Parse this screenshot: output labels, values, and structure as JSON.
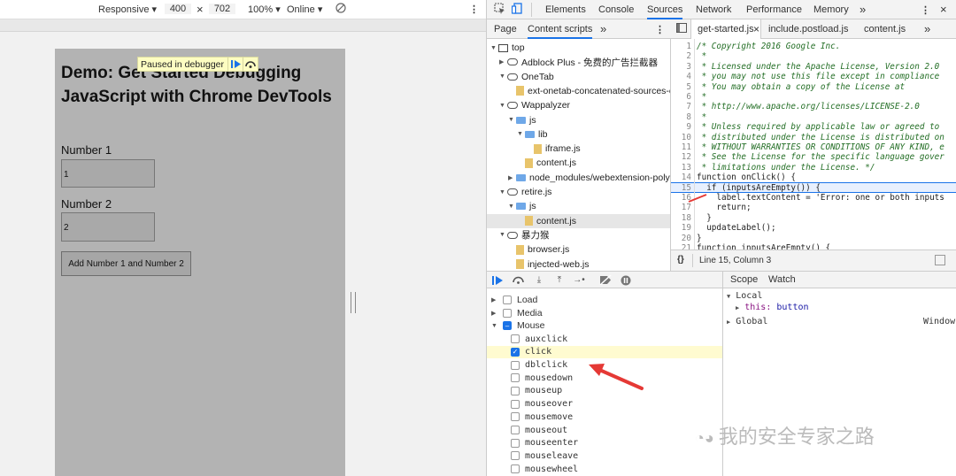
{
  "device_toolbar": {
    "mode": "Responsive",
    "width": "400",
    "x": "×",
    "height": "702",
    "zoom": "100%",
    "throttle": "Online"
  },
  "page": {
    "title": "Demo: Get Started Debugging JavaScript with Chrome DevTools",
    "paused_label": "Paused in debugger",
    "number1_label": "Number 1",
    "number1_value": "1",
    "number2_label": "Number 2",
    "number2_value": "2",
    "button_label": "Add Number 1 and Number 2"
  },
  "devtools": {
    "tabs": [
      "Elements",
      "Console",
      "Sources",
      "Network",
      "Performance",
      "Memory"
    ],
    "active_tab": "Sources",
    "more": "»",
    "navigator_tabs": {
      "page": "Page",
      "content_scripts": "Content scripts"
    },
    "tree": [
      {
        "label": "top",
        "icon": "frame",
        "depth": 0,
        "open": true
      },
      {
        "label": "Adblock Plus - 免费的广告拦截器",
        "icon": "cloud",
        "depth": 1,
        "open": false
      },
      {
        "label": "OneTab",
        "icon": "cloud",
        "depth": 1,
        "open": true
      },
      {
        "label": "ext-onetab-concatenated-sources-c",
        "icon": "file",
        "depth": 2,
        "open": null
      },
      {
        "label": "Wappalyzer",
        "icon": "cloud",
        "depth": 1,
        "open": true
      },
      {
        "label": "js",
        "icon": "folder",
        "depth": 2,
        "open": true
      },
      {
        "label": "lib",
        "icon": "folder",
        "depth": 3,
        "open": true
      },
      {
        "label": "iframe.js",
        "icon": "file",
        "depth": 4,
        "open": null
      },
      {
        "label": "content.js",
        "icon": "file",
        "depth": 3,
        "open": null
      },
      {
        "label": "node_modules/webextension-polyfil",
        "icon": "folder",
        "depth": 2,
        "open": false
      },
      {
        "label": "retire.js",
        "icon": "cloud",
        "depth": 1,
        "open": true
      },
      {
        "label": "js",
        "icon": "folder",
        "depth": 2,
        "open": true
      },
      {
        "label": "content.js",
        "icon": "file",
        "depth": 3,
        "open": null
      },
      {
        "label": "暴力猴",
        "icon": "cloud",
        "depth": 1,
        "open": true
      },
      {
        "label": "browser.js",
        "icon": "file",
        "depth": 2,
        "open": null
      },
      {
        "label": "injected-web.js",
        "icon": "file",
        "depth": 2,
        "open": null
      }
    ],
    "editor_tabs": [
      "get-started.js",
      "include.postload.js",
      "content.js"
    ],
    "editor_close": "×",
    "code": [
      {
        "n": "1",
        "t": "/* Copyright 2016 Google Inc.",
        "c": "cm"
      },
      {
        "n": "2",
        "t": " *",
        "c": "cm"
      },
      {
        "n": "3",
        "t": " * Licensed under the Apache License, Version 2.0",
        "c": "cm"
      },
      {
        "n": "4",
        "t": " * you may not use this file except in compliance",
        "c": "cm"
      },
      {
        "n": "5",
        "t": " * You may obtain a copy of the License at",
        "c": "cm"
      },
      {
        "n": "6",
        "t": " *",
        "c": "cm"
      },
      {
        "n": "7",
        "t": " * http://www.apache.org/licenses/LICENSE-2.0",
        "c": "cm"
      },
      {
        "n": "8",
        "t": " *",
        "c": "cm"
      },
      {
        "n": "9",
        "t": " * Unless required by applicable law or agreed to",
        "c": "cm"
      },
      {
        "n": "10",
        "t": " * distributed under the License is distributed on",
        "c": "cm"
      },
      {
        "n": "11",
        "t": " * WITHOUT WARRANTIES OR CONDITIONS OF ANY KIND, e",
        "c": "cm"
      },
      {
        "n": "12",
        "t": " * See the License for the specific language gover",
        "c": "cm"
      },
      {
        "n": "13",
        "t": " * limitations under the License. */",
        "c": "cm"
      },
      {
        "n": "14",
        "t": "function onClick() {",
        "c": ""
      },
      {
        "n": "15",
        "t": "  if (inputsAreEmpty()) {",
        "c": "hl"
      },
      {
        "n": "16",
        "t": "    label.textContent = 'Error: one or both inputs",
        "c": ""
      },
      {
        "n": "17",
        "t": "    return;",
        "c": ""
      },
      {
        "n": "18",
        "t": "  }",
        "c": ""
      },
      {
        "n": "19",
        "t": "  updateLabel();",
        "c": ""
      },
      {
        "n": "20",
        "t": "}",
        "c": ""
      },
      {
        "n": "21",
        "t": "function inputsAreEmpty() {",
        "c": ""
      }
    ],
    "status_braces": "{}",
    "status_position": "Line 15, Column 3",
    "event_breakpoints": [
      {
        "label": "Load",
        "kind": "group",
        "checked": false
      },
      {
        "label": "Media",
        "kind": "group",
        "checked": false
      },
      {
        "label": "Mouse",
        "kind": "group-open",
        "checked": "partial"
      },
      {
        "label": "auxclick",
        "kind": "item",
        "checked": false
      },
      {
        "label": "click",
        "kind": "item",
        "checked": true
      },
      {
        "label": "dblclick",
        "kind": "item",
        "checked": false
      },
      {
        "label": "mousedown",
        "kind": "item",
        "checked": false
      },
      {
        "label": "mouseup",
        "kind": "item",
        "checked": false
      },
      {
        "label": "mouseover",
        "kind": "item",
        "checked": false
      },
      {
        "label": "mousemove",
        "kind": "item",
        "checked": false
      },
      {
        "label": "mouseout",
        "kind": "item",
        "checked": false
      },
      {
        "label": "mouseenter",
        "kind": "item",
        "checked": false
      },
      {
        "label": "mouseleave",
        "kind": "item",
        "checked": false
      },
      {
        "label": "mousewheel",
        "kind": "item",
        "checked": false
      }
    ],
    "scope_tabs": {
      "scope": "Scope",
      "watch": "Watch"
    },
    "scope": {
      "local": "Local",
      "this_key": "this:",
      "this_val": "button",
      "global": "Global",
      "global_val": "Window"
    }
  },
  "watermark": "我的安全专家之路",
  "colors": {
    "accent": "#1a73e8",
    "arrow": "#e53935",
    "highlight_row": "#fffbd0"
  }
}
